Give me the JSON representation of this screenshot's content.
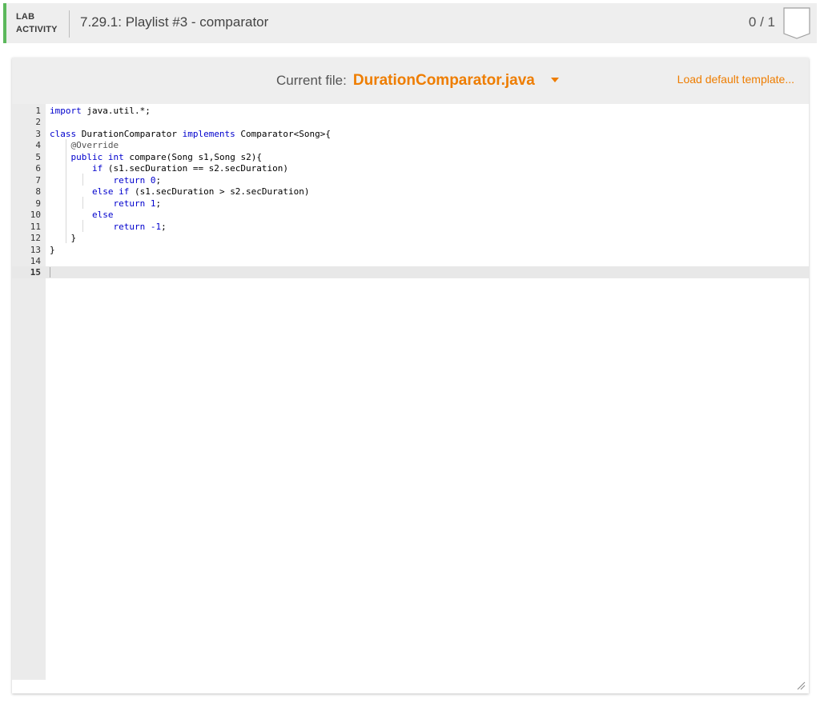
{
  "header": {
    "activity_label_line1": "LAB",
    "activity_label_line2": "ACTIVITY",
    "title": "7.29.1: Playlist #3 - comparator",
    "score": "0 / 1",
    "accent_color": "#5cb85c",
    "score_icon": "badge-icon"
  },
  "toolbar": {
    "current_file_label": "Current file:",
    "current_file_name": "DurationComparator.java",
    "load_template_label": "Load default template...",
    "accent_color": "#ee7d00"
  },
  "editor": {
    "lines": [
      {
        "n": "1",
        "text": "import java.util.*;"
      },
      {
        "n": "2",
        "text": ""
      },
      {
        "n": "3",
        "text": "class DurationComparator implements Comparator<Song>{"
      },
      {
        "n": "4",
        "text": "    @Override"
      },
      {
        "n": "5",
        "text": "    public int compare(Song s1,Song s2){"
      },
      {
        "n": "6",
        "text": "        if (s1.secDuration == s2.secDuration)"
      },
      {
        "n": "7",
        "text": "            return 0;"
      },
      {
        "n": "8",
        "text": "        else if (s1.secDuration > s2.secDuration)"
      },
      {
        "n": "9",
        "text": "            return 1;"
      },
      {
        "n": "10",
        "text": "        else"
      },
      {
        "n": "11",
        "text": "            return -1;"
      },
      {
        "n": "12",
        "text": "    }"
      },
      {
        "n": "13",
        "text": "}"
      },
      {
        "n": "14",
        "text": ""
      },
      {
        "n": "15",
        "text": ""
      }
    ],
    "active_line": "15"
  }
}
